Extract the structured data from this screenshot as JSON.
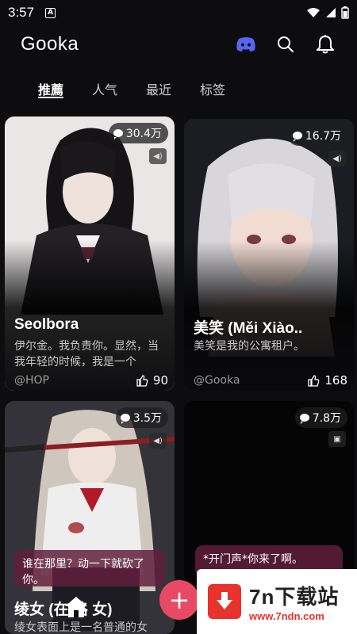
{
  "status": {
    "time": "3:57",
    "notification_badge": "A"
  },
  "header": {
    "title": "Gooka",
    "icons": [
      "discord-icon",
      "search-icon",
      "bell-icon"
    ],
    "discord_color": "#5865F2"
  },
  "tabs": [
    {
      "label": "推薦",
      "active": true
    },
    {
      "label": "人气",
      "active": false
    },
    {
      "label": "最近",
      "active": false
    },
    {
      "label": "标签",
      "active": false
    }
  ],
  "cards": [
    {
      "views": "30.4万",
      "title": "Seolbora",
      "desc": "伊尔金。我负责你。显然，当我年轻的时候，我是一个",
      "author": "@HOP",
      "likes": "90"
    },
    {
      "views": "16.7万",
      "title": "美笑 (Měi Xiào..",
      "desc": "美笑是我的公寓租户。",
      "author": "@Gooka",
      "likes": "168"
    },
    {
      "views": "3.5万",
      "dialog": "谁在那里？动一下就砍了你。",
      "title": "绫女 (在 路 女)",
      "desc": "绫女表面上是一名普通的女"
    },
    {
      "views": "7.8万",
      "dialog": "*开门声*你来了啊。"
    }
  ],
  "bottom_nav": {
    "add_label": "+"
  },
  "promo": {
    "name": "7n下载站",
    "url": "www.7ndn.com"
  },
  "accent": "#e84a66"
}
